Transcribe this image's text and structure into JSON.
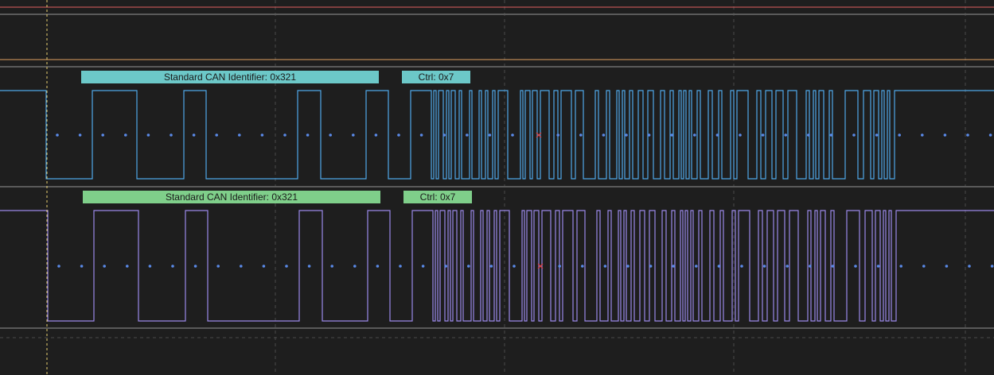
{
  "colors": {
    "background": "#1e1e1e",
    "grid": "#4a4a4a",
    "separator": "#5a5a5a",
    "trigger_marker": "#e8d070",
    "top_trace": "#e06060",
    "top_trace_2": "#e0a060",
    "ch1_wave": "#4fa8e8",
    "ch2_wave": "#9a88e8",
    "sample_dot": "#5a8ae8",
    "error_mark": "#e04040"
  },
  "channels": [
    {
      "id": "ch1",
      "id_label": "Standard CAN Identifier: 0x321",
      "ctrl_label": "Ctrl: 0x7"
    },
    {
      "id": "ch2",
      "id_label": "Standard CAN Identifier: 0x321",
      "ctrl_label": "Ctrl: 0x7"
    }
  ],
  "icons": {
    "error_marker": "x-mark-icon",
    "sample_point": "dot-icon"
  }
}
